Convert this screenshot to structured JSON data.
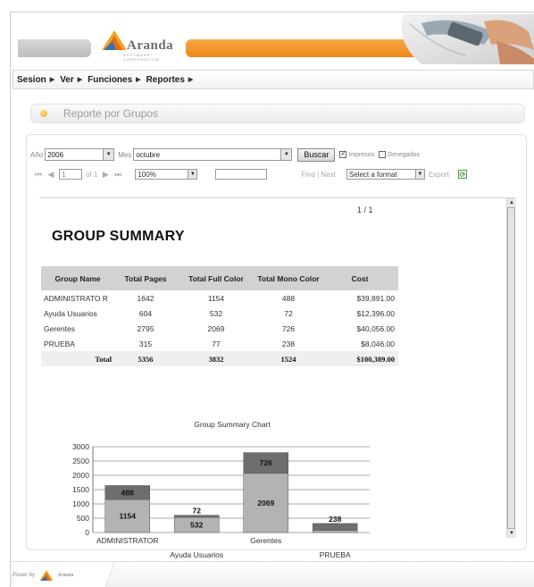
{
  "brand": {
    "name": "Aranda",
    "tagline": "SOFTWARE CORPORATION"
  },
  "menu": [
    {
      "label": "Sesion"
    },
    {
      "label": "Ver"
    },
    {
      "label": "Funciones"
    },
    {
      "label": "Reportes"
    }
  ],
  "report_panel": {
    "title": "Reporte por Grupos"
  },
  "filters": {
    "year_label": "Año",
    "year_value": "2006",
    "month_label": "Mes",
    "month_value": "octubre",
    "search_button": "Buscar",
    "printed_label": "Impresos",
    "printed_checked": true,
    "denied_label": "Denegados",
    "denied_checked": false
  },
  "toolbar": {
    "page_input": "1",
    "of_pages": "of 1",
    "zoom": "100%",
    "find_next": "Find | Next",
    "format_select": "Select a format",
    "export": "Export"
  },
  "viewer": {
    "page_indicator": "1 /   1",
    "report_title": "GROUP SUMMARY"
  },
  "table": {
    "headers": [
      "Group Name",
      "Total Pages",
      "Total Full Color",
      "Total Mono Color",
      "Cost"
    ],
    "rows": [
      [
        "ADMINISTRATO R",
        "1642",
        "1154",
        "488",
        "$39,891.00"
      ],
      [
        "Ayuda Usuarios",
        "604",
        "532",
        "72",
        "$12,396.00"
      ],
      [
        "Gerentes",
        "2795",
        "2069",
        "726",
        "$40,056.00"
      ],
      [
        "PRUEBA",
        "315",
        "77",
        "238",
        "$8,046.00"
      ]
    ],
    "total": [
      "Total",
      "5356",
      "3832",
      "1524",
      "$100,389.00"
    ]
  },
  "chart_data": {
    "type": "bar",
    "stacked": true,
    "title": "Group Summary Chart",
    "categories": [
      "ADMINISTRATOR",
      "Ayuda Usuarios",
      "Gerentes",
      "PRUEBA"
    ],
    "series": [
      {
        "values": [
          1154,
          532,
          2069,
          77
        ],
        "color": "#b3b3b3"
      },
      {
        "values": [
          488,
          72,
          726,
          238
        ],
        "color": "#6e6e6e"
      }
    ],
    "ylim": [
      0,
      3000
    ],
    "yticks": [
      0,
      500,
      1000,
      1500,
      2000,
      2500,
      3000
    ],
    "grid": true
  },
  "footer": {
    "powered_by": "Power by",
    "logo_text": "Aranda"
  },
  "colors": {
    "accent_orange": "#ee8716",
    "header_gray": "#c8c8c8"
  }
}
